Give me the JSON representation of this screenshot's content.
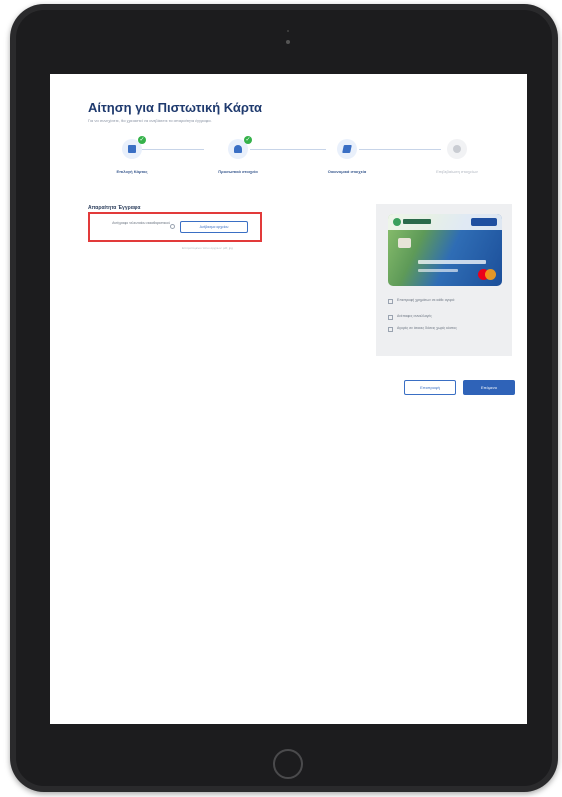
{
  "page": {
    "title": "Αίτηση για Πιστωτική Κάρτα",
    "subtitle": "Για να συνεχίσετε, θα χρειαστεί να ανεβάσετε τα απαραίτητα έγγραφα."
  },
  "steps": [
    {
      "label": "Επιλογή Κάρτας",
      "status": "completed",
      "icon": "card-icon"
    },
    {
      "label": "Προσωπικά στοιχεία",
      "status": "completed",
      "icon": "person-icon"
    },
    {
      "label": "Οικονομικά στοιχεία",
      "status": "current",
      "icon": "document-icon"
    },
    {
      "label": "Επιβεβαίωση στοιχείων",
      "status": "pending",
      "icon": "user-icon"
    }
  ],
  "documents": {
    "section_label": "Απαραίτητα Έγγραφα",
    "upload_label": "Αντίγραφο τελευταίου εκκαθαριστικού",
    "upload_button": "Ανέβασμα αρχείου",
    "upload_hint": "Επιτρεπόμενοι τύποι αρχείων: pdf, jpg"
  },
  "card_panel": {
    "benefits": [
      "Επιστροφή χρημάτων σε κάθε αγορά",
      "Ανέπαφες συναλλαγές",
      "Αγορές σε άτοκες δόσεις χωρίς κόστος"
    ]
  },
  "actions": {
    "back_label": "Επιστροφή",
    "next_label": "Επόμενο"
  },
  "colors": {
    "accent": "#2f63b8",
    "title": "#1f3a6e",
    "highlight": "#e23a3a",
    "success": "#35b24a"
  }
}
